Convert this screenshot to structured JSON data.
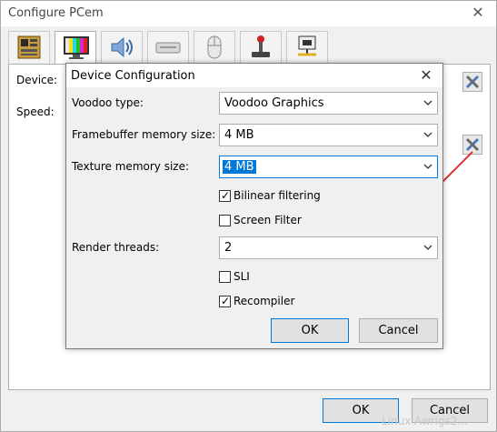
{
  "window": {
    "title": "Configure PCem",
    "close_symbol": "✕",
    "tabs": [
      {
        "icon": "motherboard-icon"
      },
      {
        "icon": "monitor-icon"
      },
      {
        "icon": "speaker-icon"
      },
      {
        "icon": "drive-icon"
      },
      {
        "icon": "mouse-icon"
      },
      {
        "icon": "joystick-icon"
      },
      {
        "icon": "network-icon"
      }
    ],
    "labels": {
      "device": "Device:",
      "speed": "Speed:"
    },
    "ok_label": "OK",
    "cancel_label": "Cancel"
  },
  "dialog": {
    "title": "Device Configuration",
    "close_symbol": "✕",
    "voodoo_type_label": "Voodoo type:",
    "voodoo_type_value": "Voodoo Graphics",
    "framebuffer_label": "Framebuffer memory size:",
    "framebuffer_value": "4 MB",
    "texture_label": "Texture memory size:",
    "texture_value": "4 MB",
    "bilinear_label": "Bilinear filtering",
    "bilinear_checked": true,
    "screen_filter_label": "Screen Filter",
    "screen_filter_checked": false,
    "render_threads_label": "Render threads:",
    "render_threads_value": "2",
    "sli_label": "SLI",
    "sli_checked": false,
    "recompiler_label": "Recompiler",
    "recompiler_checked": true,
    "ok_label": "OK",
    "cancel_label": "Cancel"
  },
  "annotation": {
    "arrow_color": "#e03030"
  },
  "watermark": "Linux Awrigs2..."
}
